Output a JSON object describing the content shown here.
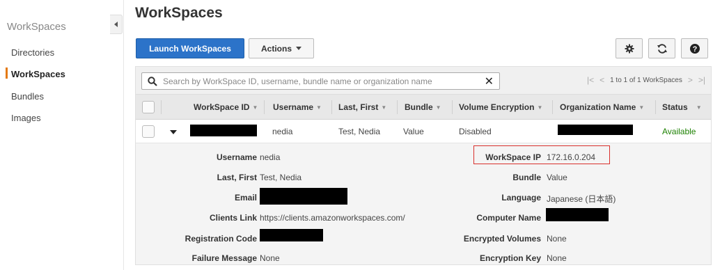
{
  "sidebar": {
    "title": "WorkSpaces",
    "items": [
      {
        "label": "Directories"
      },
      {
        "label": "WorkSpaces"
      },
      {
        "label": "Bundles"
      },
      {
        "label": "Images"
      }
    ]
  },
  "header": {
    "title": "WorkSpaces",
    "launch_label": "Launch WorkSpaces",
    "actions_label": "Actions"
  },
  "search": {
    "placeholder": "Search by WorkSpace ID, username, bundle name or organization name"
  },
  "pager": {
    "text": "1 to 1 of 1 WorkSpaces"
  },
  "columns": [
    "WorkSpace ID",
    "Username",
    "Last, First",
    "Bundle",
    "Volume Encryption",
    "Organization Name",
    "Status"
  ],
  "row": {
    "username": "nedia",
    "last_first": "Test, Nedia",
    "bundle": "Value",
    "volume_encryption": "Disabled",
    "status": "Available"
  },
  "details": {
    "left": [
      {
        "label": "Username",
        "value": "nedia"
      },
      {
        "label": "Last, First",
        "value": "Test, Nedia"
      },
      {
        "label": "Email",
        "value": ""
      },
      {
        "label": "Clients Link",
        "value": "https://clients.amazonworkspaces.com/"
      },
      {
        "label": "Registration Code",
        "value": ""
      },
      {
        "label": "Failure Message",
        "value": "None"
      }
    ],
    "right": [
      {
        "label": "WorkSpace IP",
        "value": "172.16.0.204"
      },
      {
        "label": "Bundle",
        "value": "Value"
      },
      {
        "label": "Language",
        "value": "Japanese (日本語)"
      },
      {
        "label": "Computer Name",
        "value": ""
      },
      {
        "label": "Encrypted Volumes",
        "value": "None"
      },
      {
        "label": "Encryption Key",
        "value": "None"
      }
    ]
  },
  "colors": {
    "primary": "#2c73c9",
    "available": "#1d8102",
    "active_marker": "#e47911",
    "highlight": "#d9302c"
  }
}
